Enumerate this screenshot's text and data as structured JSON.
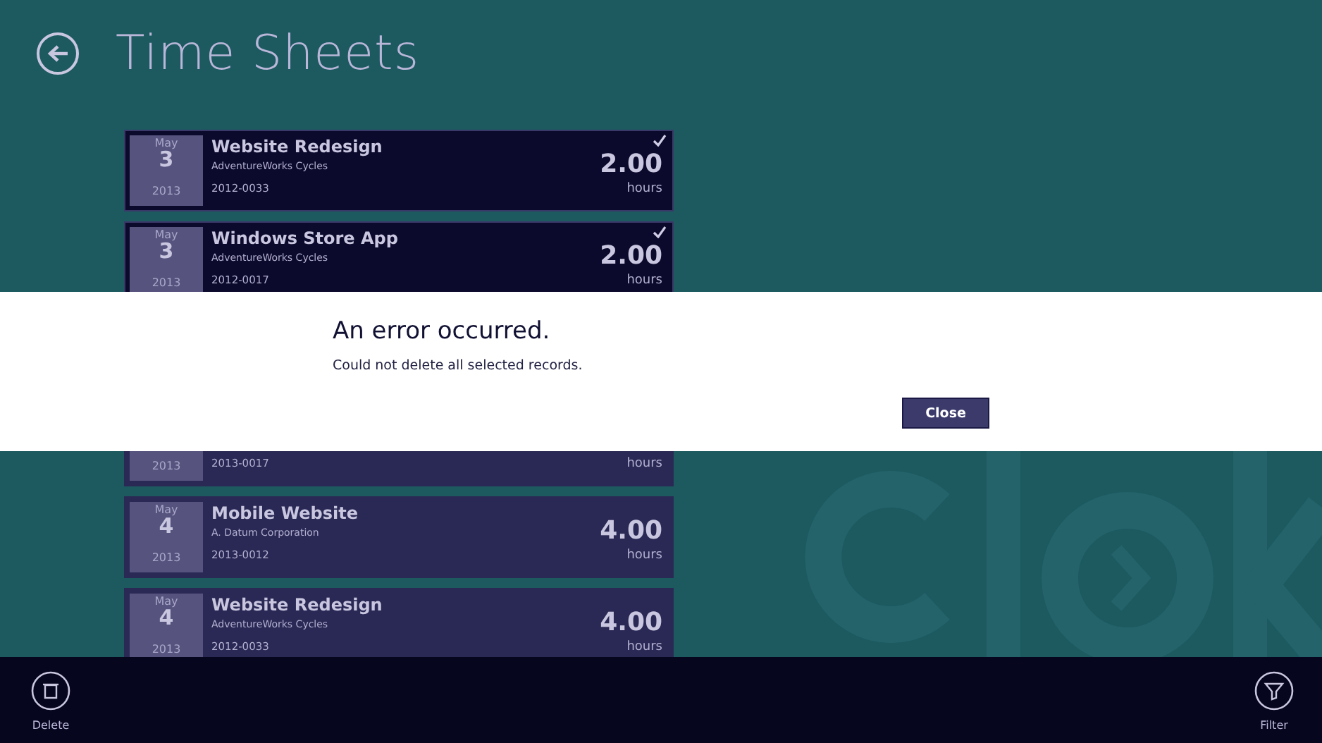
{
  "page": {
    "title": "Time Sheets"
  },
  "entries_above_dialog": [
    {
      "month": "May",
      "day": "3",
      "year": "2013",
      "project": "Website Redesign",
      "client": "AdventureWorks Cycles",
      "code": "2012-0033",
      "hours": "2.00",
      "unit": "hours",
      "selected": true
    },
    {
      "month": "May",
      "day": "3",
      "year": "2013",
      "project": "Windows Store App",
      "client": "AdventureWorks Cycles",
      "code": "2012-0017",
      "hours": "2.00",
      "unit": "hours",
      "selected": true
    }
  ],
  "entries_below_dialog": [
    {
      "year": "2013",
      "code": "2013-0017",
      "unit": "hours",
      "selected": false
    },
    {
      "month": "May",
      "day": "4",
      "year": "2013",
      "project": "Mobile Website",
      "client": "A. Datum Corporation",
      "code": "2013-0012",
      "hours": "4.00",
      "unit": "hours",
      "selected": false
    },
    {
      "month": "May",
      "day": "4",
      "year": "2013",
      "project": "Website Redesign",
      "client": "AdventureWorks Cycles",
      "code": "2012-0033",
      "hours": "4.00",
      "unit": "hours",
      "selected": false
    }
  ],
  "dialog": {
    "title": "An error occurred.",
    "message": "Could not delete all selected records.",
    "button": "Close"
  },
  "app_bar": {
    "left": [
      {
        "label": "Delete",
        "kind": "delete"
      }
    ],
    "right": [
      {
        "label": "Filter",
        "kind": "filter"
      }
    ]
  }
}
